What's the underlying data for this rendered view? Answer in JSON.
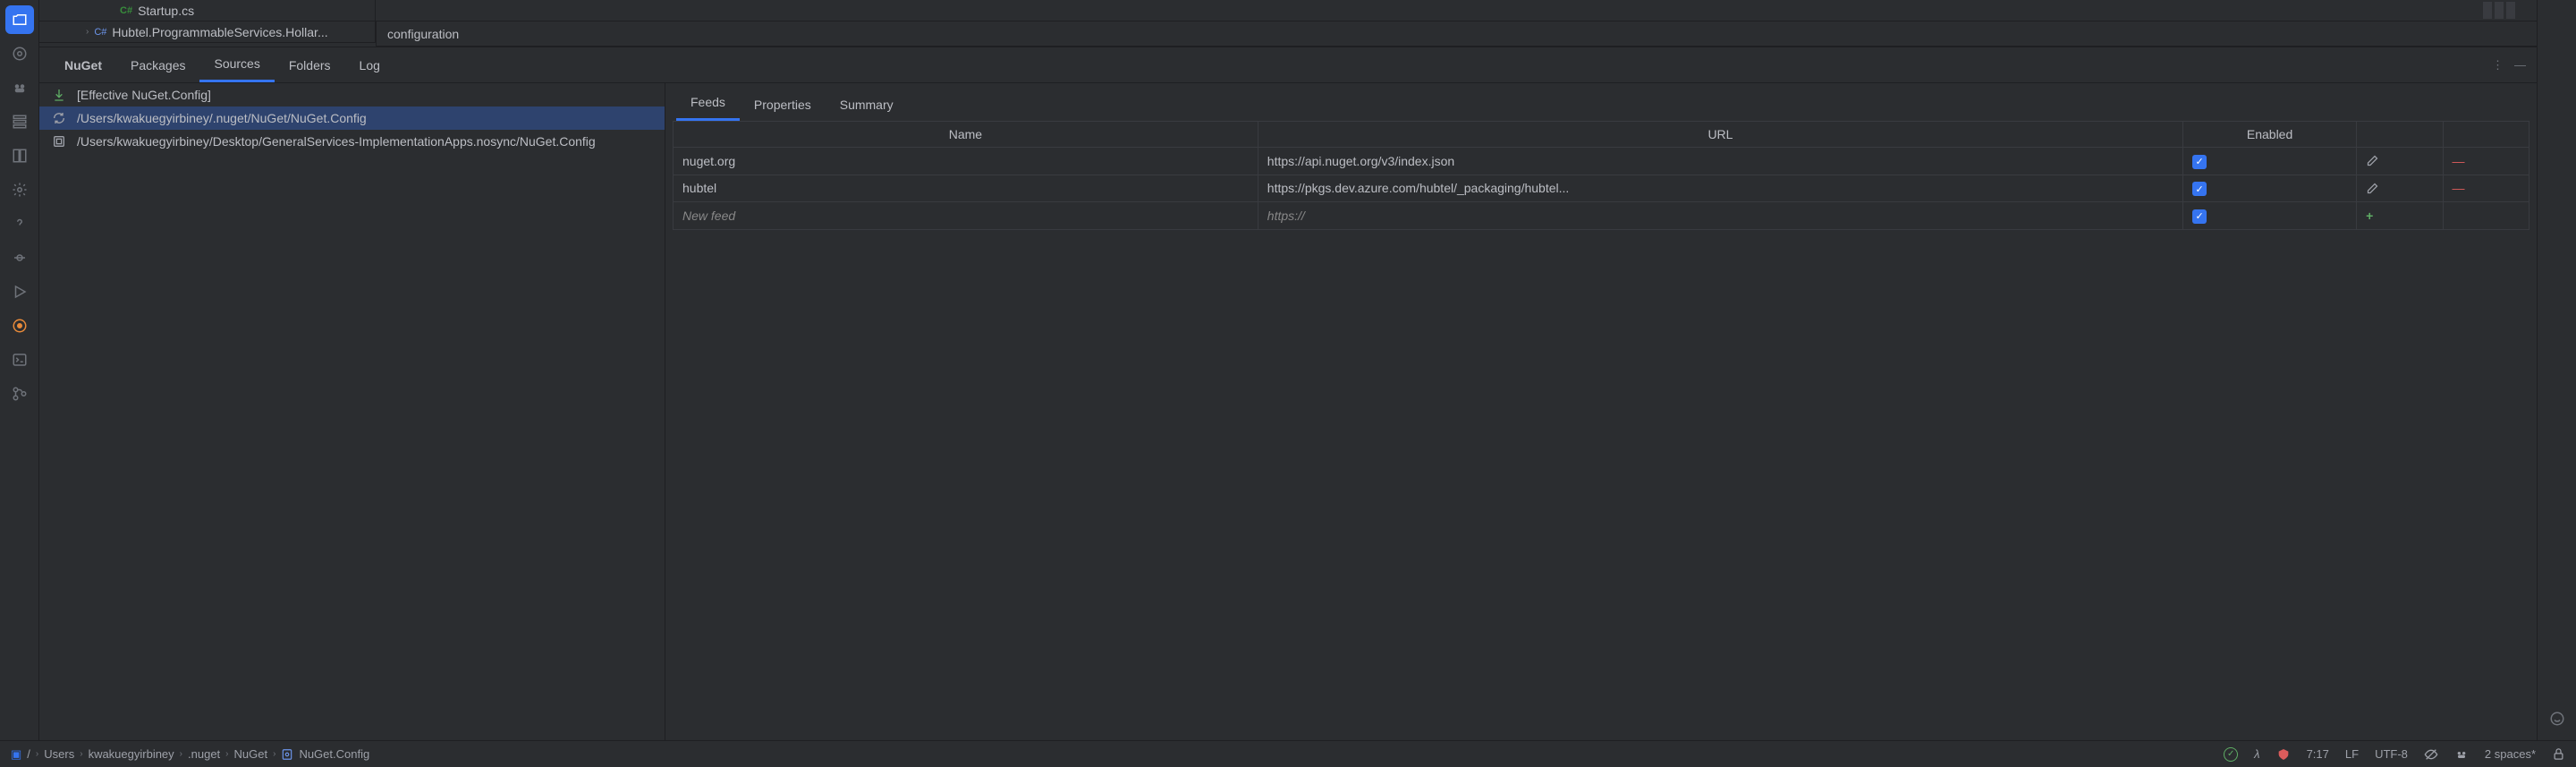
{
  "editor": {
    "file_tab": "Startup.cs",
    "file_icon": "C#",
    "tree_item": "Hubtel.ProgrammableServices.Hollar...",
    "tree_icon": "C#",
    "visible_line": "configuration"
  },
  "nuget": {
    "tabs": [
      "NuGet",
      "Packages",
      "Sources",
      "Folders",
      "Log"
    ],
    "sources": {
      "rows": [
        {
          "label": "[Effective NuGet.Config]",
          "icon": "download"
        },
        {
          "label": "/Users/kwakuegyirbiney/.nuget/NuGet/NuGet.Config",
          "icon": "sync"
        },
        {
          "label": "/Users/kwakuegyirbiney/Desktop/GeneralServices-ImplementationApps.nosync/NuGet.Config",
          "icon": "project"
        }
      ],
      "selected_index": 1
    },
    "right_tabs": [
      "Feeds",
      "Properties",
      "Summary"
    ],
    "feeds_table": {
      "headers": [
        "Name",
        "URL",
        "Enabled"
      ],
      "rows": [
        {
          "name": "nuget.org",
          "url": "https://api.nuget.org/v3/index.json",
          "enabled": true,
          "editable": true
        },
        {
          "name": "hubtel",
          "url": "https://pkgs.dev.azure.com/hubtel/_packaging/hubtel...",
          "enabled": true,
          "editable": true
        },
        {
          "name": "New feed",
          "url": "https://",
          "enabled": true,
          "new": true
        }
      ]
    }
  },
  "breadcrumb": [
    "/",
    "Users",
    "kwakuegyirbiney",
    ".nuget",
    "NuGet",
    "NuGet.Config"
  ],
  "status": {
    "cursor": "7:17",
    "line_ending": "LF",
    "encoding": "UTF-8",
    "indent": "2 spaces*"
  }
}
